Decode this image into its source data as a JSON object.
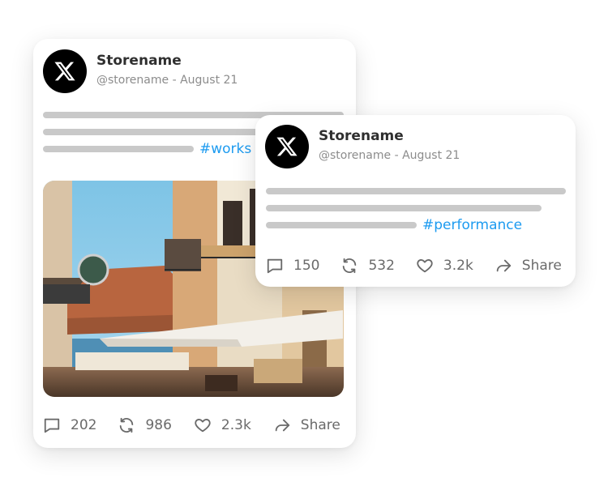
{
  "posts": [
    {
      "store_name": "Storename",
      "handle_date": "@storename - August 21",
      "hashtag": "#works",
      "has_photo": true,
      "actions": {
        "comments": "202",
        "retweets": "986",
        "likes": "2.3k",
        "share_label": "Share"
      }
    },
    {
      "store_name": "Storename",
      "handle_date": "@storename - August 21",
      "hashtag": "#performance",
      "has_photo": false,
      "actions": {
        "comments": "150",
        "retweets": "532",
        "likes": "3.2k",
        "share_label": "Share"
      }
    }
  ],
  "icons": {
    "avatar": "x-logo-icon",
    "comment": "comment-icon",
    "retweet": "retweet-icon",
    "like": "heart-icon",
    "share": "share-arrow-icon"
  },
  "colors": {
    "hashtag": "#1d9bf0",
    "avatar_bg": "#000000",
    "placeholder_bar": "#c9c9c9",
    "action_text": "#6a6a6a"
  }
}
